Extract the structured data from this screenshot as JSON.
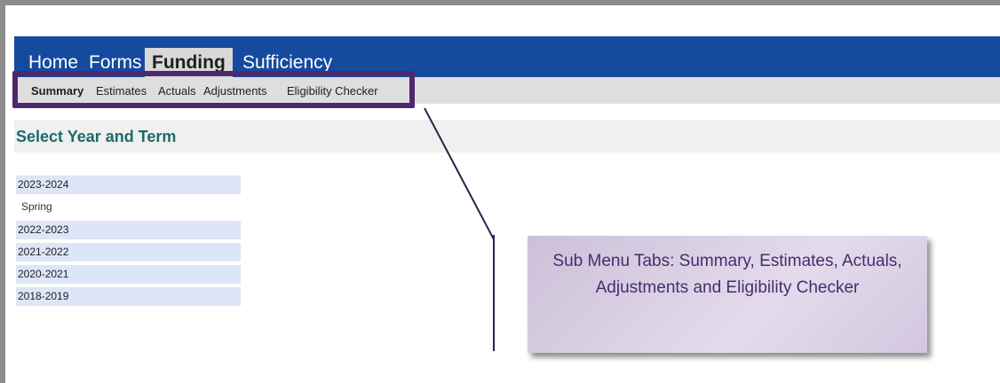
{
  "top_nav": {
    "tabs": [
      {
        "label": "Home"
      },
      {
        "label": "Forms"
      },
      {
        "label": "Funding",
        "active": true
      },
      {
        "label": "Sufficiency"
      }
    ],
    "background": "#154b9f"
  },
  "sub_nav": {
    "tabs": [
      {
        "label": "Summary",
        "active": true
      },
      {
        "label": "Estimates"
      },
      {
        "label": "Actuals"
      },
      {
        "label": "Adjustments"
      },
      {
        "label": "Eligibility Checker"
      }
    ]
  },
  "section": {
    "title": "Select Year and Term"
  },
  "years": [
    {
      "label": "2023-2024",
      "terms": [
        "Spring"
      ]
    },
    {
      "label": "2022-2023"
    },
    {
      "label": "2021-2022"
    },
    {
      "label": "2020-2021"
    },
    {
      "label": "2018-2019"
    }
  ],
  "callout": {
    "text": "Sub Menu Tabs: Summary, Estimates, Actuals, Adjustments and Eligibility Checker"
  },
  "colors": {
    "highlight_border": "#4d2a6b",
    "title": "#1d6b6b",
    "year_row": "#dce6f7"
  }
}
